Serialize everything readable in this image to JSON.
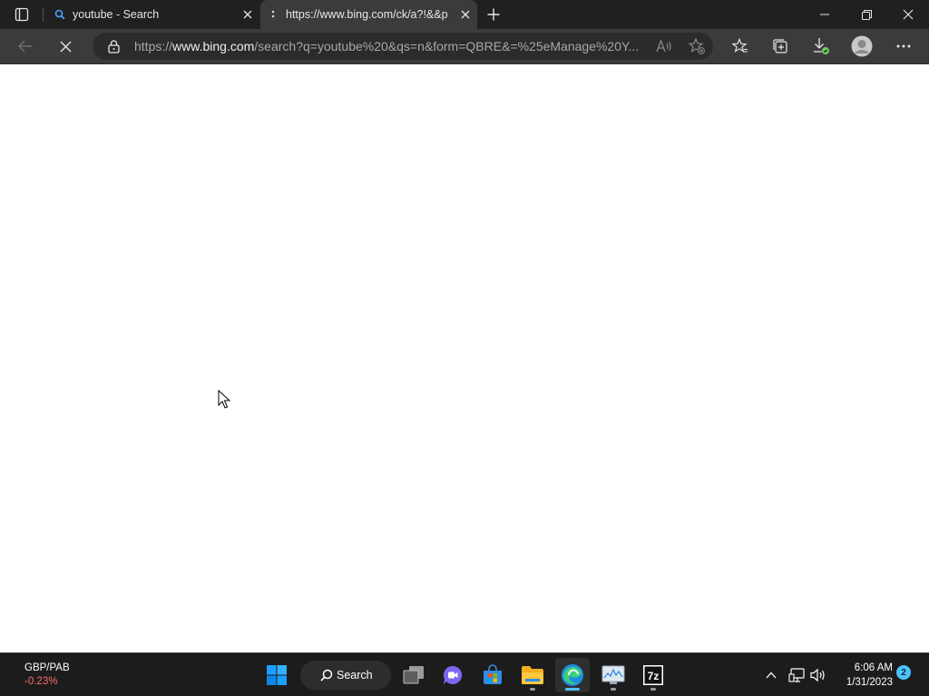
{
  "browser": {
    "tabs": [
      {
        "title": "youtube - Search",
        "icon": "search-icon",
        "active": false
      },
      {
        "title": "https://www.bing.com/ck/a?!&&p",
        "icon": "loading-icon",
        "active": true
      }
    ],
    "address": {
      "url_prefix": "https://",
      "url_host": "www.bing.com",
      "url_rest": "/search?q=youtube%20&qs=n&form=QBRE&=%25eManage%20Y..."
    }
  },
  "taskbar": {
    "widget": {
      "symbol": "GBP/PAB",
      "change": "-0.23%"
    },
    "search_label": "Search",
    "apps": [
      "start-icon",
      "search",
      "task-view-icon",
      "chat-icon",
      "store-icon",
      "file-explorer-icon",
      "edge-icon",
      "resource-monitor-icon",
      "7zip-icon"
    ],
    "clock": {
      "time": "6:06 AM",
      "date": "1/31/2023"
    },
    "notification_count": "2"
  },
  "colors": {
    "accent": "#4cc2ff",
    "titlebar": "#202020",
    "toolbar": "#3b3b3b",
    "taskbar": "#1c1c1c",
    "negative": "#ff6b6b"
  }
}
